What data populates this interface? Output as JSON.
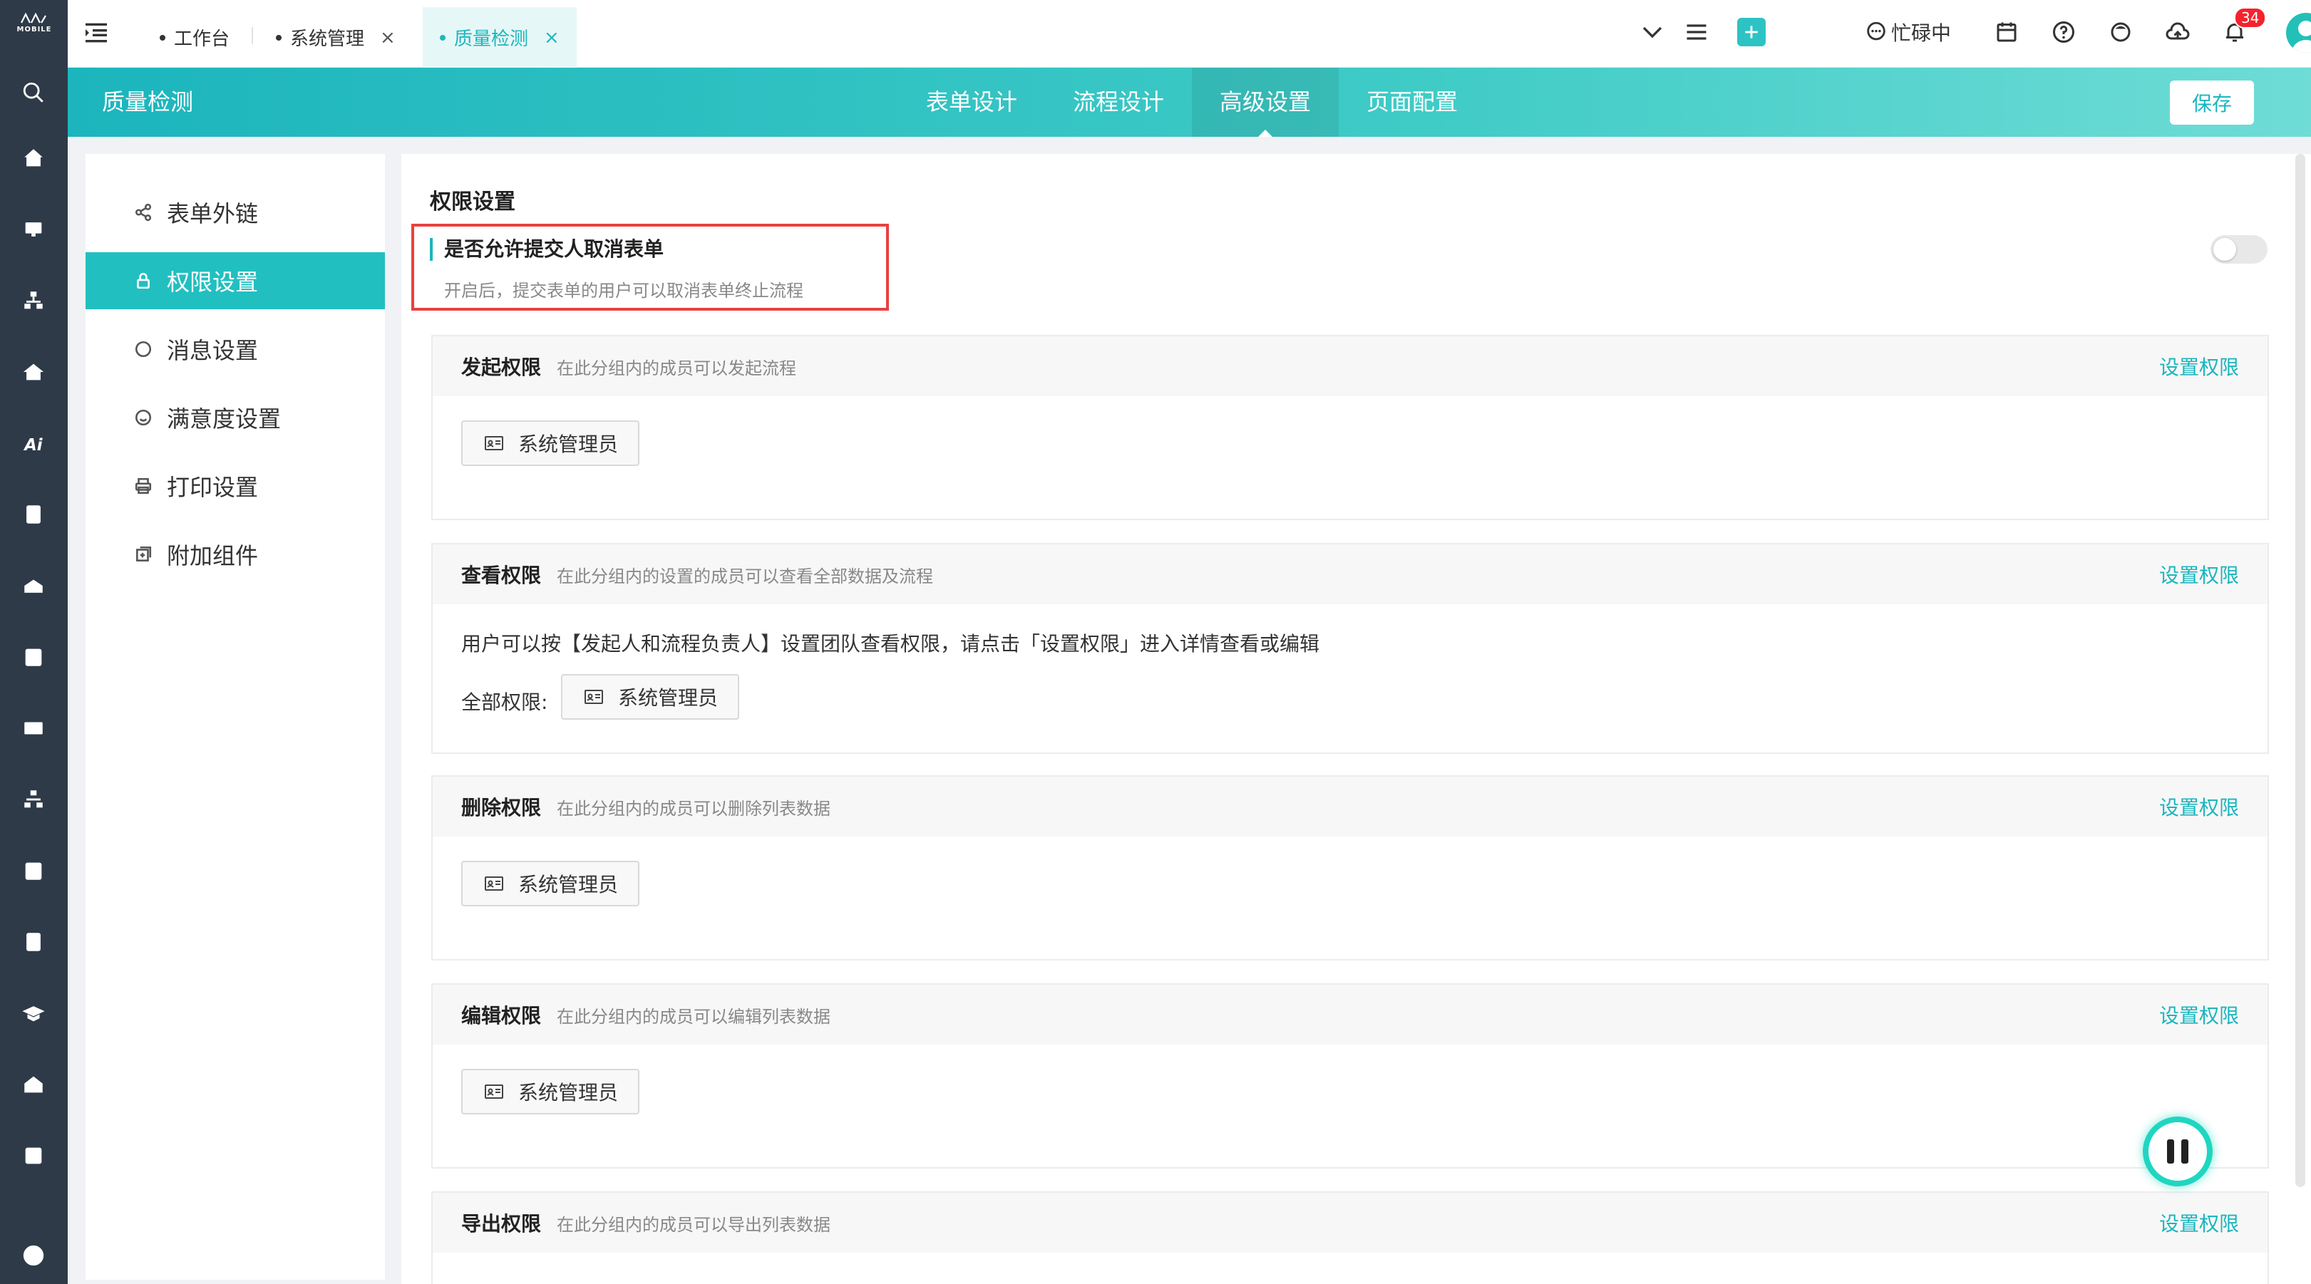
{
  "rail": {
    "logo_label": "MOBILE",
    "icons": [
      "search-icon",
      "home-icon",
      "monitor-icon",
      "org-chart-icon",
      "house-icon",
      "ai-icon",
      "contacts-icon",
      "inbox-icon",
      "calendar-icon",
      "card-icon",
      "org-chart-icon",
      "clipboard-icon",
      "yen-icon",
      "graduation-icon",
      "building-icon",
      "dashboard-icon",
      "apps-icon"
    ]
  },
  "tabs": [
    {
      "label": "工作台",
      "closable": false
    },
    {
      "label": "系统管理",
      "closable": true
    },
    {
      "label": "质量检测",
      "closable": true,
      "active": true
    }
  ],
  "toolbar": {
    "status_label": "忙碌中",
    "notification_count": "34"
  },
  "header": {
    "title": "质量检测",
    "tabs": [
      "表单设计",
      "流程设计",
      "高级设置",
      "页面配置"
    ],
    "active_tab": "高级设置",
    "save_label": "保存"
  },
  "side_menu": {
    "items": [
      {
        "label": "表单外链",
        "icon": "share-icon"
      },
      {
        "label": "权限设置",
        "icon": "lock-icon",
        "active": true
      },
      {
        "label": "消息设置",
        "icon": "message-icon"
      },
      {
        "label": "满意度设置",
        "icon": "smile-icon"
      },
      {
        "label": "打印设置",
        "icon": "printer-icon"
      },
      {
        "label": "附加组件",
        "icon": "addon-icon"
      }
    ]
  },
  "main": {
    "section_title": "权限设置",
    "cancel_option": {
      "title": "是否允许提交人取消表单",
      "description": "开启后，提交表单的用户可以取消表单终止流程",
      "enabled": false
    },
    "set_permission_label": "设置权限",
    "member_label": "系统管理员",
    "cards": [
      {
        "title": "发起权限",
        "desc": "在此分组内的成员可以发起流程"
      },
      {
        "title": "查看权限",
        "desc": "在此分组内的设置的成员可以查看全部数据及流程",
        "note": "用户可以按【发起人和流程负责人】设置团队查看权限，请点击「设置权限」进入详情查看或编辑",
        "all_label": "全部权限:"
      },
      {
        "title": "删除权限",
        "desc": "在此分组内的成员可以删除列表数据"
      },
      {
        "title": "编辑权限",
        "desc": "在此分组内的成员可以编辑列表数据"
      },
      {
        "title": "导出权限",
        "desc": "在此分组内的成员可以导出列表数据"
      }
    ]
  },
  "colors": {
    "accent": "#1cb5bd",
    "rail": "#2e3a48",
    "highlight_border": "#e8413f",
    "badge": "#f5222d"
  }
}
